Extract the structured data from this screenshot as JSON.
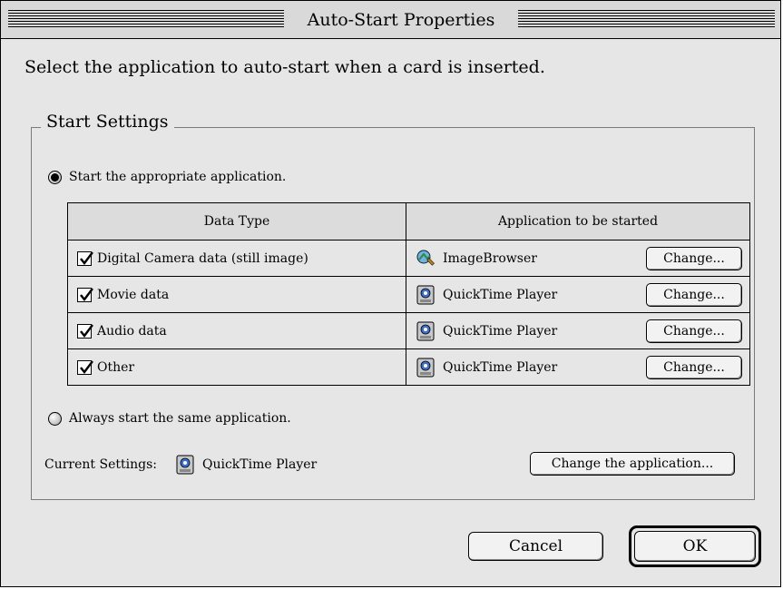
{
  "window": {
    "title": "Auto-Start Properties"
  },
  "instruction": "Select the application to auto-start when a card is inserted.",
  "group": {
    "label": "Start Settings"
  },
  "option_appropriate": {
    "label": "Start the appropriate application.",
    "selected": true
  },
  "table": {
    "headers": [
      "Data Type",
      "Application to be started"
    ],
    "rows": [
      {
        "checked": true,
        "data_type": "Digital Camera data (still image)",
        "app": "ImageBrowser",
        "app_icon": "imagebrowser-icon",
        "button": "Change..."
      },
      {
        "checked": true,
        "data_type": "Movie data",
        "app": "QuickTime Player",
        "app_icon": "quicktime-icon",
        "button": "Change..."
      },
      {
        "checked": true,
        "data_type": "Audio data",
        "app": "QuickTime Player",
        "app_icon": "quicktime-icon",
        "button": "Change..."
      },
      {
        "checked": true,
        "data_type": "Other",
        "app": "QuickTime Player",
        "app_icon": "quicktime-icon",
        "button": "Change..."
      }
    ]
  },
  "option_same": {
    "label": "Always start the same application.",
    "selected": false
  },
  "current": {
    "label": "Current Settings:",
    "app": "QuickTime Player",
    "app_icon": "quicktime-icon"
  },
  "change_app_button": "Change the application...",
  "buttons": {
    "cancel": "Cancel",
    "ok": "OK"
  }
}
